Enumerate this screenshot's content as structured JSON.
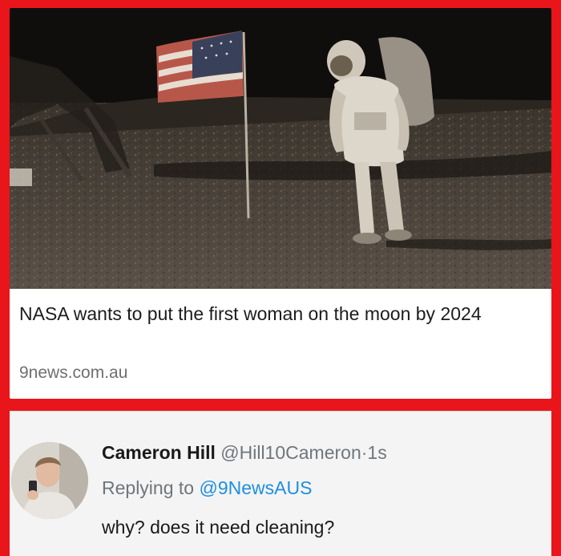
{
  "article": {
    "image_icon": "moon-landing-photo",
    "headline": "NASA wants to put the first woman on the moon by 2024",
    "source": "9news.com.au"
  },
  "tweet": {
    "avatar_icon": "user-avatar-photo",
    "name": "Cameron Hill",
    "handle": "@Hill10Cameron",
    "separator": "·",
    "time": "1s",
    "replying_prefix": "Replying to",
    "replying_to": "@9NewsAUS",
    "text": "why? does it need cleaning?"
  },
  "colors": {
    "frame": "#e8151b",
    "link": "#1d8fe0",
    "muted": "#6e767d"
  }
}
